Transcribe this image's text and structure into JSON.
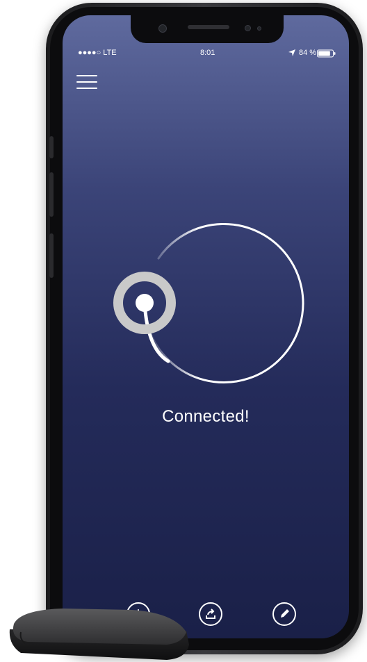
{
  "status_bar": {
    "signal": "●●●●○ LTE",
    "time": "8:01",
    "battery_percent": "84 %",
    "battery_level": 0.84
  },
  "main": {
    "status_text": "Connected!"
  },
  "bottom_nav": {
    "icons": [
      "history-icon",
      "share-icon",
      "edit-icon"
    ]
  },
  "colors": {
    "screen_top": "#5f6a9e",
    "screen_bottom": "#1a2048",
    "ring": "#c9c9c9",
    "foreground": "#ffffff"
  }
}
